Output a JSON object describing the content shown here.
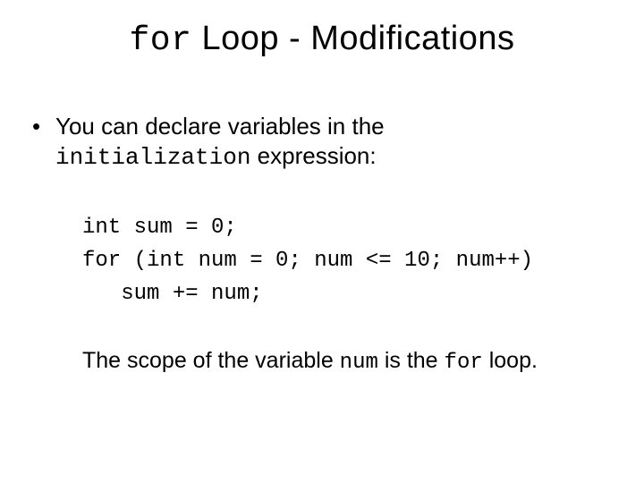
{
  "title": {
    "keyword": "for",
    "rest": " Loop - Modifications"
  },
  "bullet": {
    "line1": "You can declare variables in the",
    "line2_code": "initialization",
    "line2_rest": " expression:"
  },
  "code": {
    "line1": "int sum = 0;",
    "line2": "for (int num = 0; num <= 10; num++)",
    "line3": "   sum += num;"
  },
  "footnote": {
    "pre": "The scope of the variable ",
    "var": "num",
    "mid": " is the ",
    "kw": "for",
    "post": " loop."
  }
}
